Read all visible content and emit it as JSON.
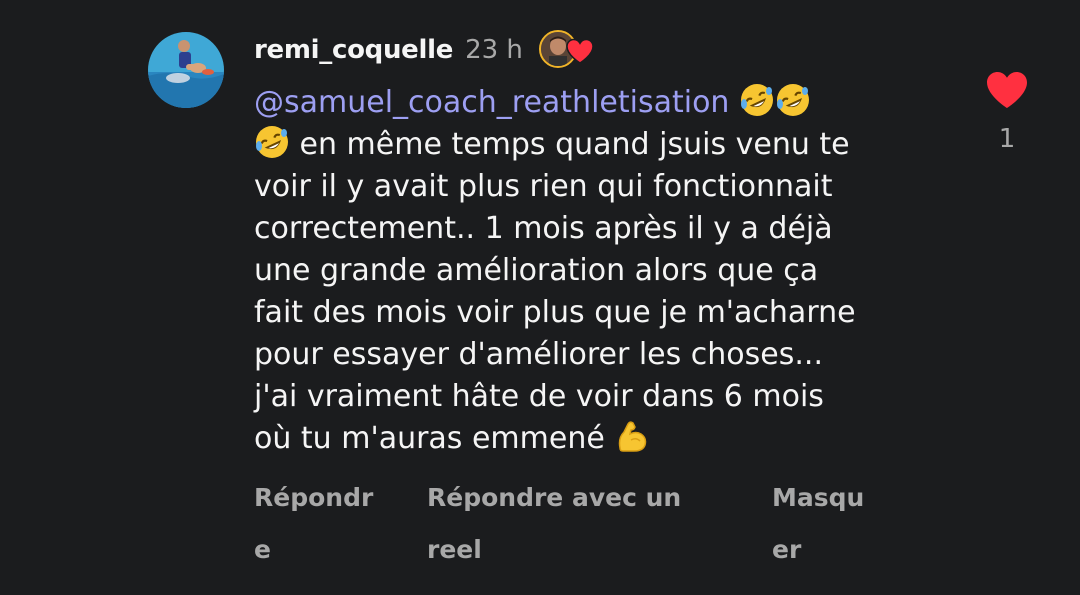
{
  "comment": {
    "username": "remi_coquelle",
    "time": "23 h",
    "mention": "@samuel_coach_reathletisation",
    "text_line_1": " en même temps quand jsuis venu te",
    "text_line_2": "voir il y avait plus rien qui fonctionnait",
    "text_line_3": "correctement.. 1 mois après il y a déjà",
    "text_line_4": "une grande amélioration alors que ça",
    "text_line_5": "fait des mois voir plus que je m'acharne",
    "text_line_6": "pour essayer d'améliorer les choses...",
    "text_line_7": "j'ai vraiment hâte de voir dans 6 mois",
    "text_line_8": "où tu m'auras emmené",
    "emojis": [
      "rolling-on-floor-laughing",
      "rolling-on-floor-laughing",
      "rolling-on-floor-laughing",
      "flexed-biceps"
    ]
  },
  "actions": {
    "reply_line_1": "Répondr",
    "reply_line_2": "e",
    "reply_reel_line_1": "Répondre avec un",
    "reply_reel_line_2": "reel",
    "hide_line_1": "Masqu",
    "hide_line_2": "er"
  },
  "like": {
    "count": "1",
    "liked": true
  },
  "colors": {
    "background": "#1b1c1e",
    "mention": "#9d9ff2",
    "heart": "#ff3040",
    "muted": "#a8a8a8"
  }
}
